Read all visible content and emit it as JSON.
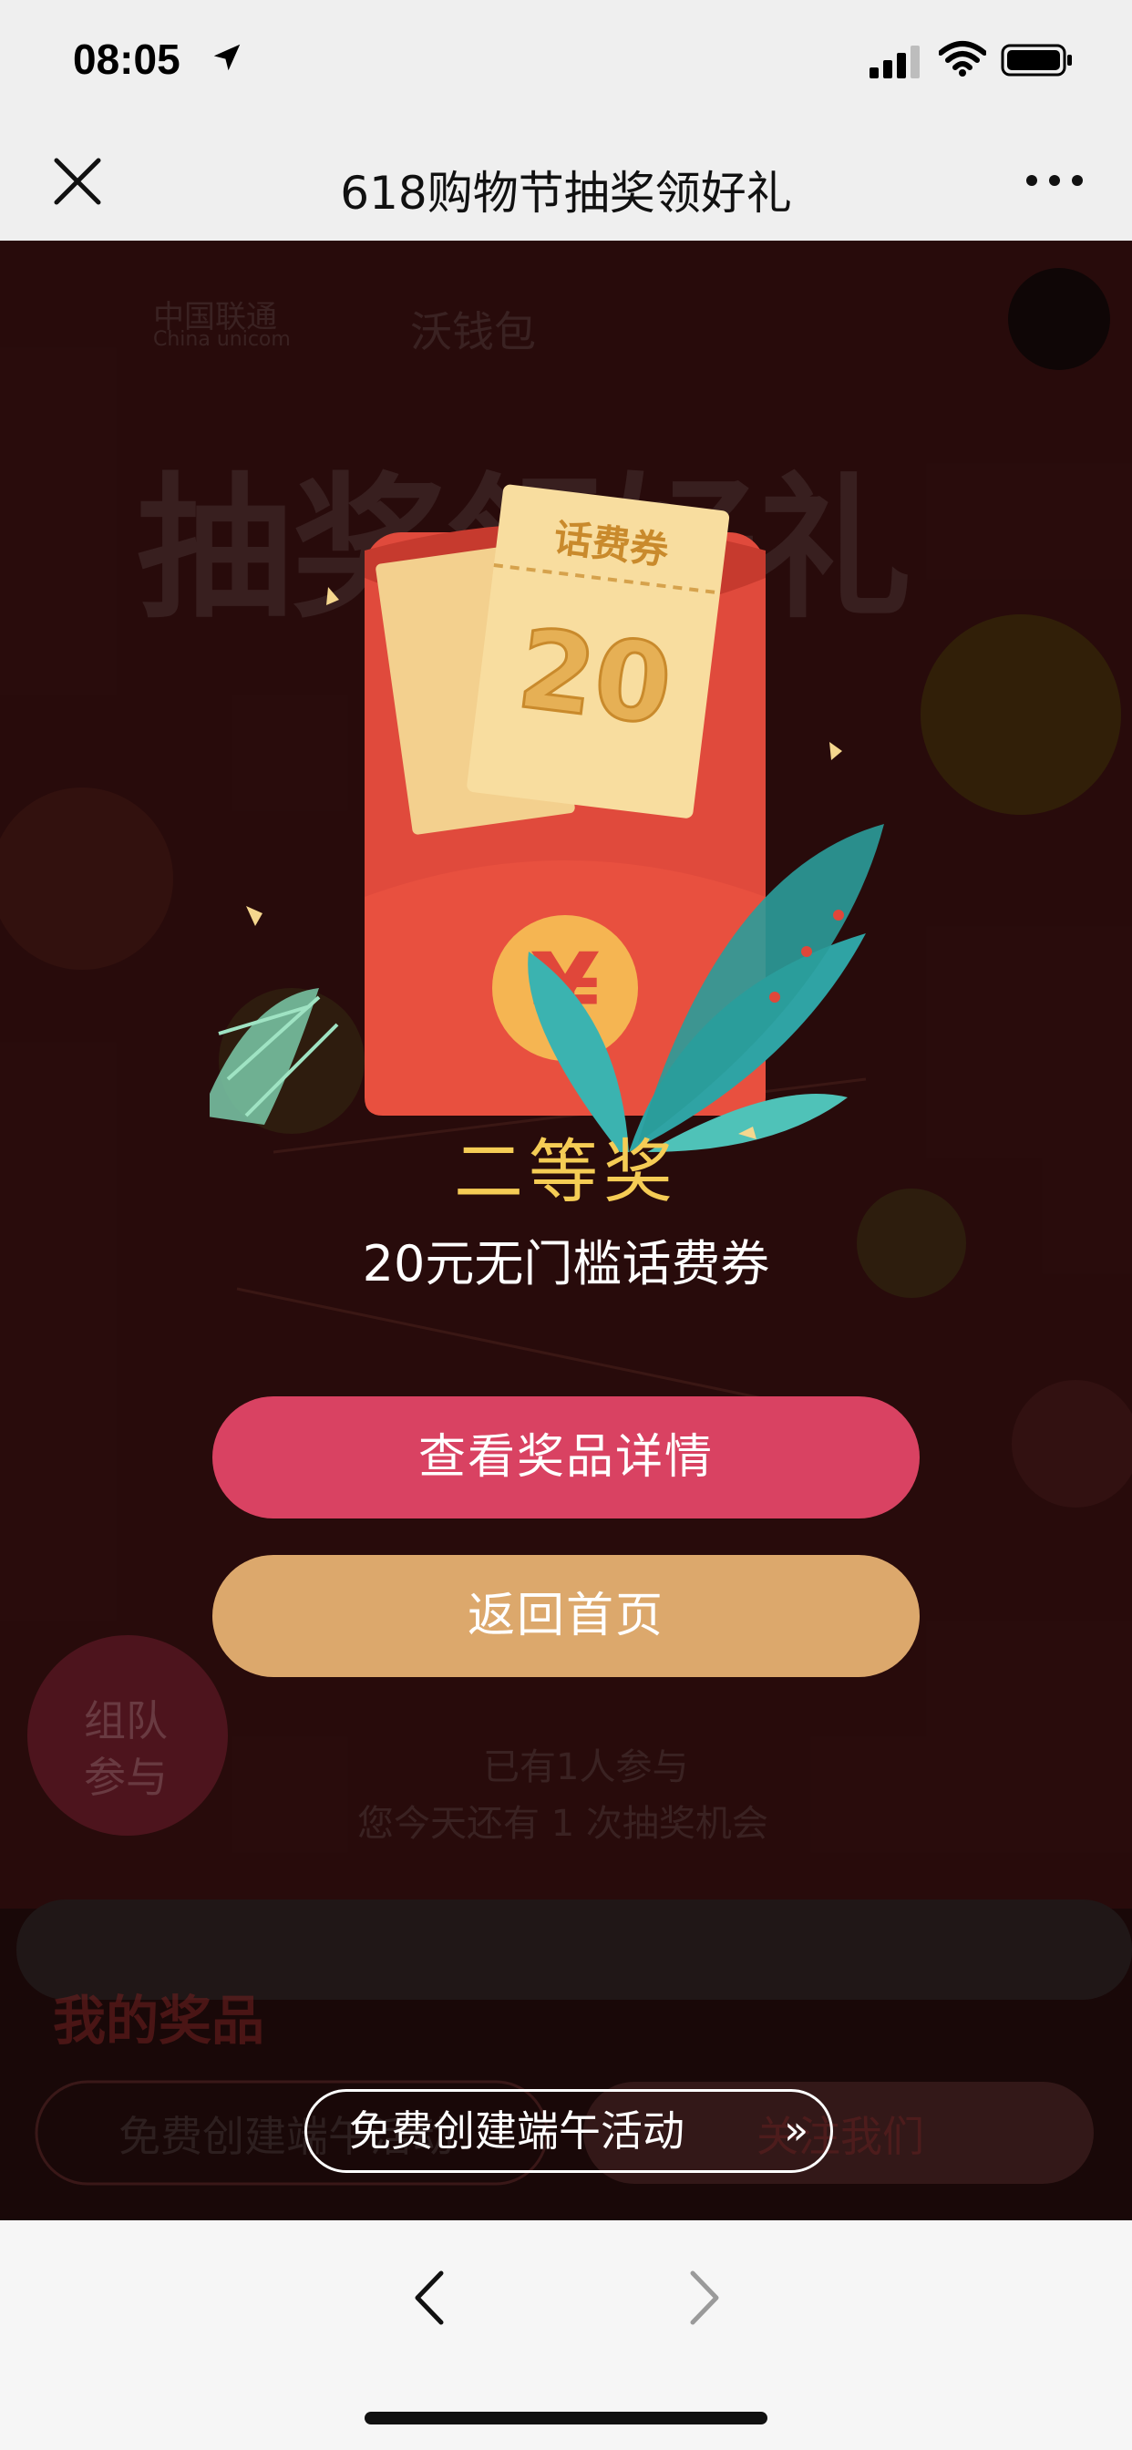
{
  "status": {
    "time": "08:05",
    "icons": [
      "location-arrow-icon",
      "cellular-signal-icon",
      "wifi-icon",
      "battery-icon"
    ]
  },
  "nav": {
    "title": "618购物节抽奖领好礼",
    "close_icon": "close-icon",
    "more_icon": "more-icon"
  },
  "background": {
    "brand_cn": "中国联通",
    "brand_en": "China unicom",
    "wallet": "沃钱包",
    "headline": "抽奖领好礼",
    "team_join_line1": "组队",
    "team_join_line2": "参与",
    "participants": "已有1人参与",
    "chances": "您今天还有 1 次抽奖机会",
    "my_prizes": "我的奖品",
    "left_pill": "免费创建端午活动",
    "right_pill": "关注我们"
  },
  "prize": {
    "coupon_label": "话费券",
    "coupon_value": "20",
    "title": "二等奖",
    "description": "20元无门槛话费券"
  },
  "buttons": {
    "details": "查看奖品详情",
    "home": "返回首页",
    "free_create": "免费创建端午活动",
    "free_create_chevron": "»"
  },
  "colors": {
    "accent_gold": "#f5cc55",
    "details_button": "#d94262",
    "home_button": "#dca86c",
    "envelope_red": "#e04a3c"
  }
}
